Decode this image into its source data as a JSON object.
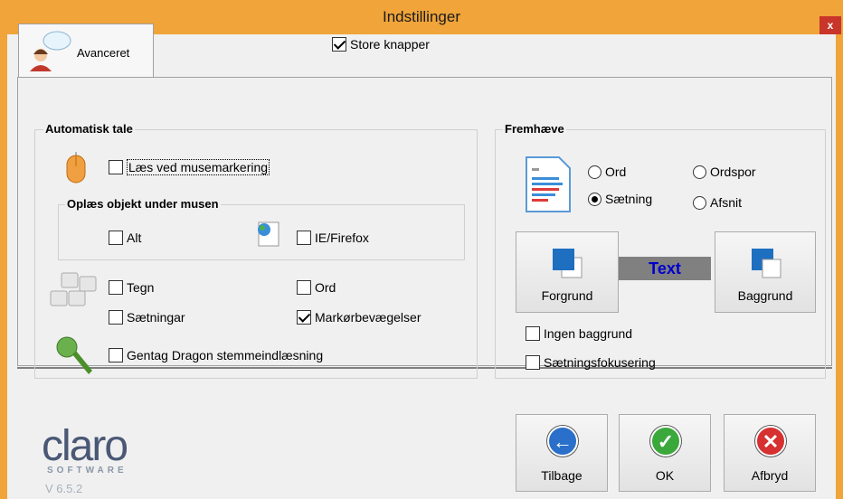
{
  "window": {
    "title": "Indstillinger",
    "close_glyph": "x",
    "accent_color": "#f0a43a"
  },
  "tabs": [
    {
      "label": "Avanceret",
      "icon": "user-chat-icon"
    }
  ],
  "store_knapper": {
    "label": "Store knapper",
    "checked": true
  },
  "automatisk_tale": {
    "title": "Automatisk tale",
    "laes_ved_musemarkering": {
      "label": "Læs ved musemarkering",
      "checked": false
    },
    "oplaes_group": {
      "title": "Oplæs objekt under musen",
      "alt": {
        "label": "Alt",
        "checked": false
      },
      "ie_firefox": {
        "label": "IE/Firefox",
        "checked": false
      }
    },
    "tegn": {
      "label": "Tegn",
      "checked": false
    },
    "ord": {
      "label": "Ord",
      "checked": false
    },
    "saetningar": {
      "label": "Sætningar",
      "checked": false
    },
    "markoerbevaegelser": {
      "label": "Markørbevægelser",
      "checked": true
    },
    "gentag_dragon": {
      "label": "Gentag Dragon stemmeindlæsning",
      "checked": false
    }
  },
  "fremhaeve": {
    "title": "Fremhæve",
    "radios": [
      {
        "label": "Ord",
        "checked": false
      },
      {
        "label": "Ordspor",
        "checked": false
      },
      {
        "label": "Sætning",
        "checked": true
      },
      {
        "label": "Afsnit",
        "checked": false
      }
    ],
    "forgrund_label": "Forgrund",
    "baggrund_label": "Baggrund",
    "preview_text": "Text",
    "preview_text_color": "#0000cc",
    "preview_bg_color": "#808080",
    "ingen_baggrund": {
      "label": "Ingen baggrund",
      "checked": false
    },
    "saetningsfokusering": {
      "label": "Sætningsfokusering",
      "checked": false
    }
  },
  "footer": {
    "logo_text": "claro",
    "logo_sub": "SOFTWARE",
    "version": "V 6.5.2",
    "buttons": [
      {
        "label": "Tilbage",
        "icon": "back-arrow-icon",
        "color": "#2a6fc9",
        "glyph": "←"
      },
      {
        "label": "OK",
        "icon": "ok-check-icon",
        "color": "#3aa83a",
        "glyph": "✓"
      },
      {
        "label": "Afbryd",
        "icon": "cancel-x-icon",
        "color": "#d63030",
        "glyph": "✕"
      }
    ]
  }
}
